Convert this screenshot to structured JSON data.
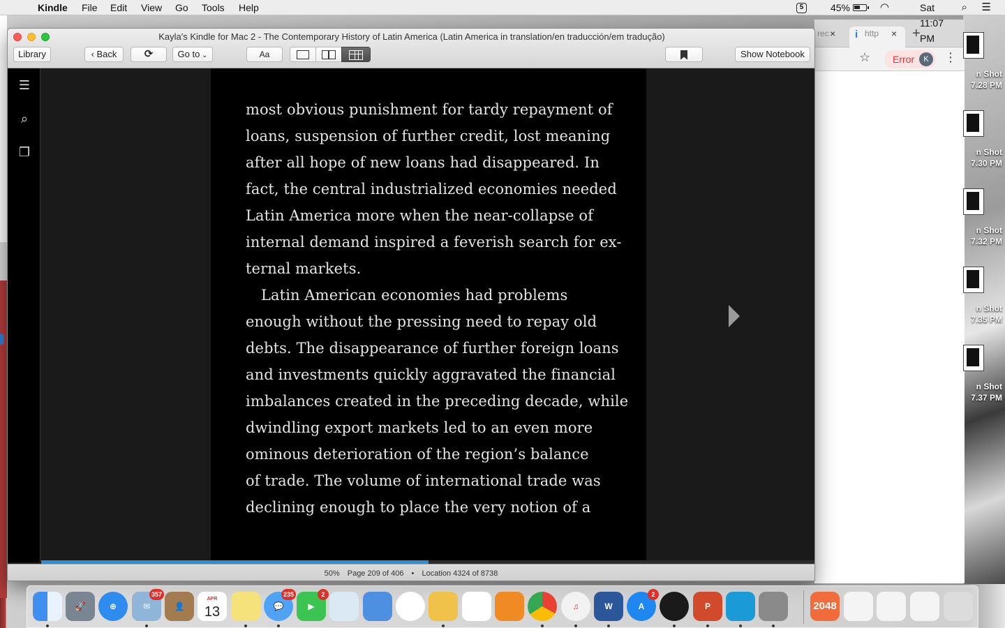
{
  "menubar": {
    "app": "Kindle",
    "items": [
      "File",
      "Edit",
      "View",
      "Go",
      "Tools",
      "Help"
    ],
    "status_five": "5",
    "battery": "45%",
    "clock": "Sat 11:07 PM"
  },
  "window": {
    "title": "Kayla's Kindle for Mac 2 - The Contemporary History of Latin America (Latin America in translation/en traducción/em tradução)"
  },
  "toolbar": {
    "library": "Library",
    "back": "Back",
    "goto": "Go to",
    "font": "Aa",
    "notebook": "Show Notebook"
  },
  "page": {
    "lines": [
      "most obvious punishment for tardy repayment of",
      "loans, suspension of further credit, lost meaning",
      "after all hope of new loans had disappeared. In",
      "fact, the central industrialized economies needed",
      "Latin America more when the near-collapse of",
      "internal demand inspired a feverish search for ex-",
      "ternal markets.",
      "Latin American economies had problems",
      "enough without the pressing need to repay old",
      "debts. The disappearance of further foreign loans",
      "and investments quickly aggravated the financial",
      "imbalances created in the preceding decade, while",
      "dwindling export markets led to an even more",
      "ominous deterioration of the region’s balance",
      "of trade. The volume of international trade was",
      "declining enough to place the very notion of a"
    ]
  },
  "status": {
    "percent": "50%",
    "page": "Page 209 of 406",
    "location": "Location 4324 of 8738",
    "progress_fraction": 0.5
  },
  "browser": {
    "tab1_text": "rec",
    "tab2_text": "http",
    "error_label": "Error",
    "avatar": "K"
  },
  "desktop": {
    "files": [
      {
        "caption1": "n Shot",
        "caption2": "7.28 PM"
      },
      {
        "caption1": "n Shot",
        "caption2": "7.30 PM"
      },
      {
        "caption1": "n Shot",
        "caption2": "7.32 PM"
      },
      {
        "caption1": "n Shot",
        "caption2": "7.35 PM"
      },
      {
        "caption1": "n Shot",
        "caption2": "7.37 PM"
      }
    ]
  },
  "dock": {
    "badges": {
      "mail": "357",
      "messages": "235",
      "facetime": "2",
      "appstore": "2"
    },
    "calendar_month": "APR",
    "calendar_day": "13",
    "game_2048": "2048"
  }
}
